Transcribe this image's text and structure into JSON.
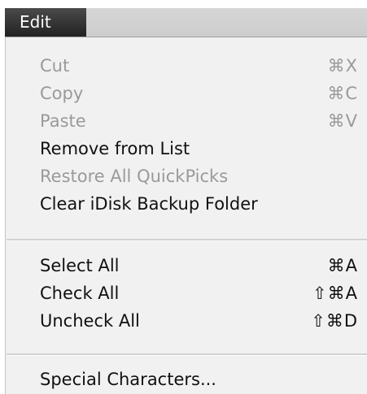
{
  "menubar": {
    "title": "Edit"
  },
  "menu": {
    "items": [
      {
        "label": "Cut",
        "shortcut": "⌘X"
      },
      {
        "label": "Copy",
        "shortcut": "⌘C"
      },
      {
        "label": "Paste",
        "shortcut": "⌘V"
      },
      {
        "label": "Remove from List",
        "shortcut": ""
      },
      {
        "label": "Restore All QuickPicks",
        "shortcut": ""
      },
      {
        "label": "Clear iDisk Backup Folder",
        "shortcut": ""
      },
      {
        "label": "Select All",
        "shortcut": "⌘A"
      },
      {
        "label": "Check All",
        "shortcut": "⇧⌘A"
      },
      {
        "label": "Uncheck All",
        "shortcut": "⇧⌘D"
      },
      {
        "label": "Special Characters...",
        "shortcut": ""
      }
    ]
  },
  "colors": {
    "enabled_text": "#111111",
    "disabled_text": "#9a9a9a",
    "menu_background": "#f1f1f1",
    "title_background": "#2f2f2f"
  }
}
